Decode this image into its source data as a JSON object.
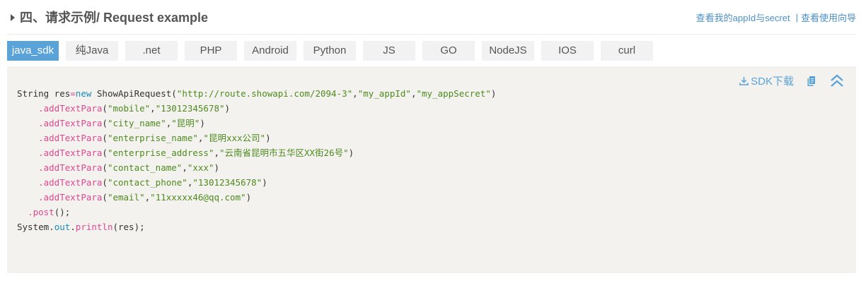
{
  "header": {
    "title": "四、请求示例/ Request example",
    "link_appid": "查看我的appId与secret",
    "separator": "|",
    "link_guide": "查看使用向导"
  },
  "tabs": [
    {
      "label": "java_sdk",
      "active": true
    },
    {
      "label": "纯Java",
      "active": false
    },
    {
      "label": ".net",
      "active": false
    },
    {
      "label": "PHP",
      "active": false
    },
    {
      "label": "Android",
      "active": false
    },
    {
      "label": "Python",
      "active": false
    },
    {
      "label": "JS",
      "active": false
    },
    {
      "label": "GO",
      "active": false
    },
    {
      "label": "NodeJS",
      "active": false
    },
    {
      "label": "IOS",
      "active": false
    },
    {
      "label": "curl",
      "active": false
    }
  ],
  "tools": {
    "sdk_download": "SDK下载",
    "copy_icon": "copy-icon",
    "collapse_icon": "collapse-up-icon",
    "download_icon": "download-icon"
  },
  "code": {
    "line1": {
      "a": "String res",
      "b": "=",
      "c": "new",
      "d": " ShowApiRequest(",
      "e": "\"http://route.showapi.com/2094-3\"",
      "f": ",",
      "g": "\"my_appId\"",
      "h": ",",
      "i": "\"my_appSecret\"",
      "j": ")"
    },
    "params": [
      {
        "method": ".addTextPara",
        "key": "\"mobile\"",
        "value": "\"13012345678\""
      },
      {
        "method": ".addTextPara",
        "key": "\"city_name\"",
        "value": "\"昆明\""
      },
      {
        "method": ".addTextPara",
        "key": "\"enterprise_name\"",
        "value": "\"昆明xxx公司\""
      },
      {
        "method": ".addTextPara",
        "key": "\"enterprise_address\"",
        "value": "\"云南省昆明市五华区XX街26号\""
      },
      {
        "method": ".addTextPara",
        "key": "\"contact_name\"",
        "value": "\"xxx\""
      },
      {
        "method": ".addTextPara",
        "key": "\"contact_phone\"",
        "value": "\"13012345678\""
      },
      {
        "method": ".addTextPara",
        "key": "\"email\"",
        "value": "\"11xxxxx46@qq.com\""
      }
    ],
    "post": ".post",
    "post_end": "();",
    "print_a": "System",
    "print_b": ".",
    "print_c": "out",
    "print_d": ".",
    "print_e": "println",
    "print_f": "(res);"
  },
  "colors": {
    "accent": "#5aa3d8",
    "string": "#4e8a1e",
    "method": "#e0478f",
    "keyword": "#1a8ab5",
    "panel_bg": "#f4f2ef"
  }
}
